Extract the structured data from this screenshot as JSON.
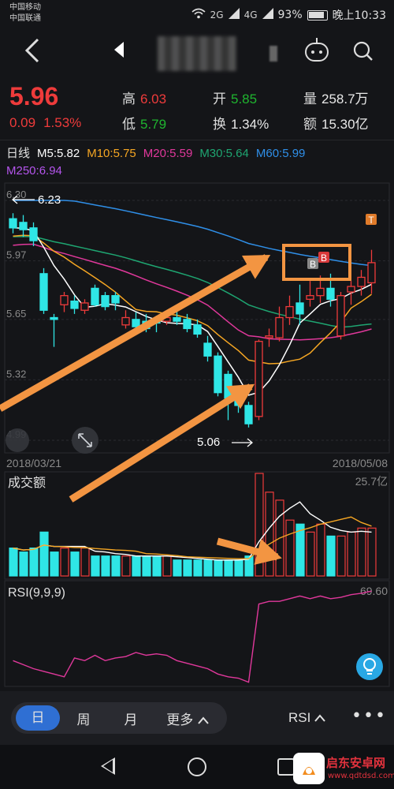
{
  "status_bar": {
    "carrier1": "中国移动",
    "carrier2": "中国联通",
    "network1": "2G",
    "network2": "4G",
    "battery": "93%",
    "time": "晚上10:33"
  },
  "nav": {
    "back_icon": "chevron-left-icon",
    "prev_icon": "triangle-left-icon",
    "robot_icon": "robot-icon",
    "search_icon": "search-icon"
  },
  "quote": {
    "price": "5.96",
    "change": "0.09",
    "change_pct": "1.53%",
    "high_label": "高",
    "high": "6.03",
    "low_label": "低",
    "low": "5.79",
    "open_label": "开",
    "open": "5.85",
    "turnover_label": "换",
    "turnover": "1.34%",
    "volume_label": "量",
    "volume": "258.7万",
    "amount_label": "额",
    "amount": "15.30亿"
  },
  "ma": {
    "period": "日线",
    "m5": "M5:5.82",
    "m10": "M10:5.75",
    "m20": "M20:5.59",
    "m30": "M30:5.64",
    "m60": "M60:5.99",
    "m250": "M250:6.94"
  },
  "colors": {
    "up": "#ee3b3b",
    "down": "#2fe6e6",
    "m5": "#ffffff",
    "m10": "#f5a623",
    "m20": "#e0389b",
    "m30": "#1ea571",
    "m60": "#2f8fe8",
    "m250": "#b455ec",
    "annotation": "#f39542"
  },
  "chart_data": [
    {
      "type": "candlestick",
      "title": "",
      "x_start": "2018/03/21",
      "x_end": "2018/05/08",
      "y_ticks": [
        "6.30",
        "5.97",
        "5.65",
        "5.32",
        "4.99"
      ],
      "ylim": [
        4.99,
        6.3
      ],
      "high_marker": "6.23",
      "low_marker": "5.06",
      "markers": [
        "B",
        "B",
        "T"
      ],
      "candles": [
        {
          "o": 6.2,
          "h": 6.23,
          "l": 6.12,
          "c": 6.15
        },
        {
          "o": 6.18,
          "h": 6.22,
          "l": 6.1,
          "c": 6.14
        },
        {
          "o": 6.15,
          "h": 6.18,
          "l": 6.05,
          "c": 6.08
        },
        {
          "o": 5.9,
          "h": 5.93,
          "l": 5.68,
          "c": 5.7
        },
        {
          "o": 5.66,
          "h": 5.68,
          "l": 5.5,
          "c": 5.65
        },
        {
          "o": 5.73,
          "h": 5.8,
          "l": 5.69,
          "c": 5.78
        },
        {
          "o": 5.75,
          "h": 5.78,
          "l": 5.68,
          "c": 5.71
        },
        {
          "o": 5.7,
          "h": 5.76,
          "l": 5.68,
          "c": 5.74
        },
        {
          "o": 5.82,
          "h": 5.84,
          "l": 5.72,
          "c": 5.73
        },
        {
          "o": 5.78,
          "h": 5.8,
          "l": 5.7,
          "c": 5.72
        },
        {
          "o": 5.78,
          "h": 5.8,
          "l": 5.7,
          "c": 5.74
        },
        {
          "o": 5.62,
          "h": 5.7,
          "l": 5.6,
          "c": 5.66
        },
        {
          "o": 5.65,
          "h": 5.69,
          "l": 5.58,
          "c": 5.61
        },
        {
          "o": 5.64,
          "h": 5.68,
          "l": 5.58,
          "c": 5.6
        },
        {
          "o": 5.64,
          "h": 5.67,
          "l": 5.58,
          "c": 5.63
        },
        {
          "o": 5.64,
          "h": 5.69,
          "l": 5.62,
          "c": 5.66
        },
        {
          "o": 5.66,
          "h": 5.7,
          "l": 5.62,
          "c": 5.64
        },
        {
          "o": 5.65,
          "h": 5.68,
          "l": 5.58,
          "c": 5.6
        },
        {
          "o": 5.62,
          "h": 5.65,
          "l": 5.55,
          "c": 5.57
        },
        {
          "o": 5.52,
          "h": 5.56,
          "l": 5.42,
          "c": 5.45
        },
        {
          "o": 5.45,
          "h": 5.47,
          "l": 5.23,
          "c": 5.25
        },
        {
          "o": 5.35,
          "h": 5.37,
          "l": 5.1,
          "c": 5.22
        },
        {
          "o": 5.22,
          "h": 5.25,
          "l": 5.14,
          "c": 5.18
        },
        {
          "o": 5.18,
          "h": 5.2,
          "l": 5.06,
          "c": 5.08
        },
        {
          "o": 5.12,
          "h": 5.54,
          "l": 5.1,
          "c": 5.53
        },
        {
          "o": 5.55,
          "h": 5.6,
          "l": 5.5,
          "c": 5.56
        },
        {
          "o": 5.55,
          "h": 5.72,
          "l": 5.53,
          "c": 5.66
        },
        {
          "o": 5.66,
          "h": 5.78,
          "l": 5.62,
          "c": 5.72
        },
        {
          "o": 5.74,
          "h": 5.84,
          "l": 5.62,
          "c": 5.68
        },
        {
          "o": 5.76,
          "h": 5.86,
          "l": 5.72,
          "c": 5.78
        },
        {
          "o": 5.78,
          "h": 5.89,
          "l": 5.74,
          "c": 5.82
        },
        {
          "o": 5.82,
          "h": 5.9,
          "l": 5.72,
          "c": 5.76
        },
        {
          "o": 5.56,
          "h": 5.8,
          "l": 5.54,
          "c": 5.78
        },
        {
          "o": 5.8,
          "h": 5.86,
          "l": 5.73,
          "c": 5.83
        },
        {
          "o": 5.83,
          "h": 5.92,
          "l": 5.78,
          "c": 5.88
        },
        {
          "o": 5.85,
          "h": 6.03,
          "l": 5.79,
          "c": 5.96
        }
      ]
    },
    {
      "type": "bar",
      "title": "成交额",
      "max_label": "25.7亿",
      "ylim": [
        0,
        25.7
      ],
      "values": [
        7,
        6,
        7,
        11,
        6,
        7,
        6,
        7,
        5,
        5,
        5,
        5,
        5,
        5,
        5,
        5,
        4,
        4,
        4,
        4,
        4,
        4,
        4,
        5,
        25.7,
        21,
        19,
        14,
        13,
        11,
        13,
        10,
        10,
        11,
        12,
        12
      ]
    },
    {
      "type": "line",
      "title": "RSI(9,9,9)",
      "max_label": "69.60",
      "ylim": [
        0,
        75
      ],
      "values": [
        18,
        15,
        12,
        10,
        8,
        6,
        20,
        18,
        22,
        18,
        20,
        21,
        24,
        22,
        23,
        22,
        18,
        16,
        14,
        12,
        8,
        6,
        5,
        2,
        60,
        62,
        62,
        64,
        66,
        64,
        66,
        64,
        65,
        67,
        68,
        69.6
      ]
    }
  ],
  "volume_panel_label": "成交额",
  "rsi_panel_label": "RSI(9,9,9)",
  "bottom_tabs": {
    "day": "日",
    "week": "周",
    "month": "月",
    "more": "更多",
    "indicator": "RSI",
    "more_icon": "ellipsis-icon"
  },
  "watermark": {
    "title": "启东安卓网",
    "url": "www.qdtdsd.com"
  }
}
